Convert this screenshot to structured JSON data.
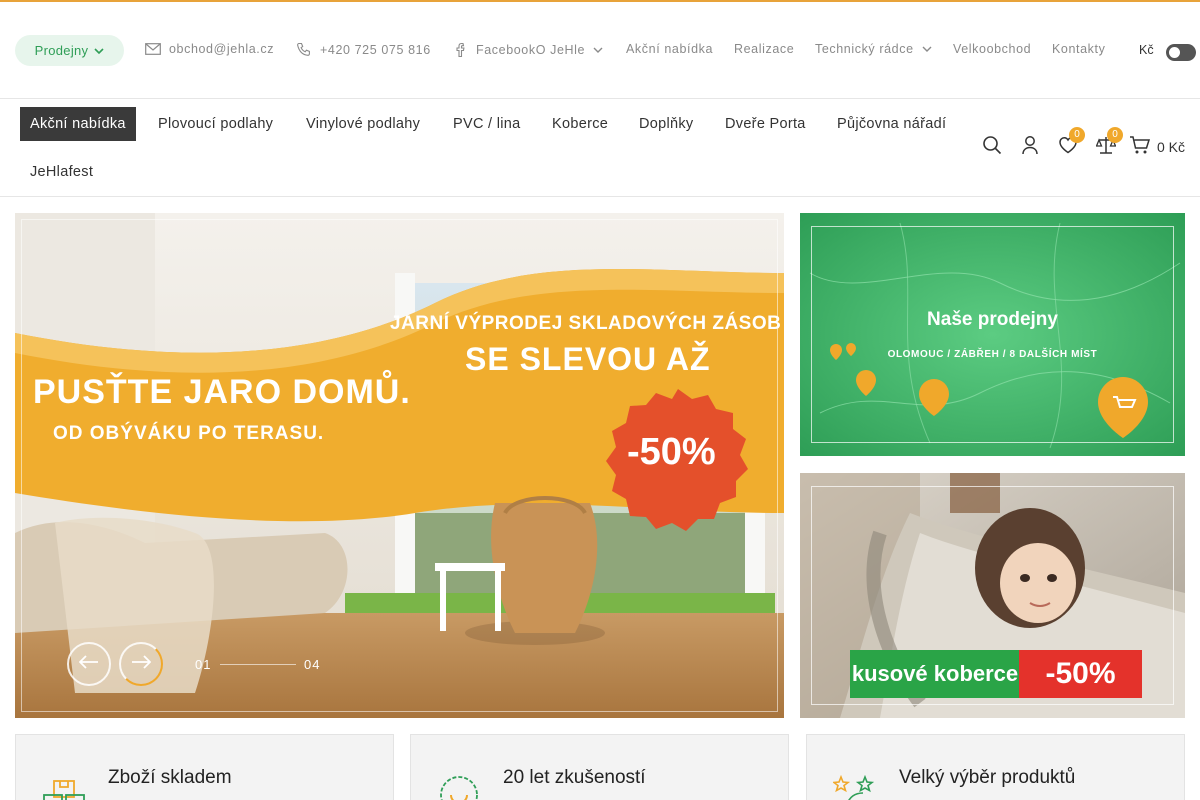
{
  "topbar": {
    "stores_label": "Prodejny",
    "email": "obchod@jehla.cz",
    "phone": "+420 725 075 816",
    "facebook": "FacebookO JeHle",
    "links": [
      "Akční nabídka",
      "Realizace",
      "Technický rádce",
      "Velkoobchod",
      "Kontakty"
    ],
    "currency": "Kč"
  },
  "nav": {
    "items": [
      "Akční nabídka",
      "Plovoucí podlahy",
      "Vinylové podlahy",
      "PVC / lina",
      "Koberce",
      "Doplňky",
      "Dveře Porta",
      "Půjčovna nářadí",
      "JeHlafest"
    ],
    "wishlist_count": "0",
    "compare_count": "0",
    "cart_total": "0 Kč"
  },
  "hero": {
    "headline": "PUSŤTE JARO DOMŮ.",
    "subline": "OD OBÝVÁKU PO TERASU.",
    "right_line1": "JARNÍ VÝPRODEJ SKLADOVÝCH ZÁSOB",
    "right_line2": "SE SLEVOU AŽ",
    "discount": "-50%",
    "slide_current": "01",
    "slide_total": "04"
  },
  "banners": {
    "stores_title": "Naše prodejny",
    "stores_sub": "OLOMOUC / ZÁBŘEH / 8 DALŠÍCH MÍST",
    "rug_label": "kusové koberce",
    "rug_discount": "-50%"
  },
  "features": [
    {
      "title": "Zboží skladem"
    },
    {
      "title": "20 let zkušeností"
    },
    {
      "title": "Velký výběr produktů"
    }
  ],
  "colors": {
    "accent": "#f0a82b",
    "green": "#2f9e57",
    "dark": "#3a3a3a"
  }
}
